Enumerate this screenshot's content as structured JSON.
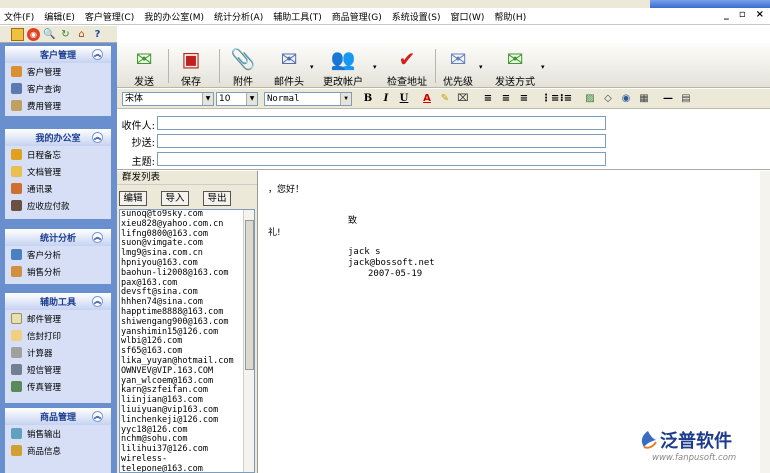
{
  "menu": [
    "文件(F)",
    "编辑(E)",
    "客户管理(C)",
    "我的办公室(M)",
    "统计分析(A)",
    "辅助工具(T)",
    "商品管理(G)",
    "系统设置(S)",
    "窗口(W)",
    "帮助(H)"
  ],
  "window_controls": [
    "_",
    "ₐ",
    "×"
  ],
  "sidebar": {
    "groups": [
      {
        "title": "客户管理",
        "items": [
          "客户管理",
          "客户查询",
          "费用管理"
        ]
      },
      {
        "title": "我的办公室",
        "items": [
          "日程备忘",
          "文档管理",
          "通讯录",
          "应收应付款"
        ]
      },
      {
        "title": "统计分析",
        "items": [
          "客户分析",
          "销售分析"
        ]
      },
      {
        "title": "辅助工具",
        "items": [
          "邮件管理",
          "信封打印",
          "计算器",
          "短信管理",
          "传真管理"
        ]
      },
      {
        "title": "商品管理",
        "items": [
          "销售输出",
          "商品信息"
        ]
      }
    ]
  },
  "toolbar": {
    "buttons": [
      "发送",
      "保存",
      "附件",
      "邮件头",
      "更改帐户",
      "检查地址",
      "优先级",
      "发送方式"
    ]
  },
  "format": {
    "font": "宋体",
    "size": "10",
    "style": "Normal",
    "buttons": [
      "B",
      "I",
      "U"
    ]
  },
  "header": {
    "to_label": "收件人:",
    "cc_label": "抄送:",
    "subject_label": "主题:"
  },
  "group_send": {
    "title": "群发列表",
    "buttons": [
      "编辑",
      "导入",
      "导出"
    ],
    "emails": [
      "sunoq@to9sky.com",
      "xieu828@yahoo.com.cn",
      "lifng0800@163.com",
      "suon@vimgate.com",
      "lmg9@sina.com.cn",
      "hpniyou@163.com",
      "baohun-li2008@163.com",
      "pax@163.com",
      "devsft@sina.com",
      "hhhen74@sina.com",
      "happtime8888@163.com",
      "shiwengang900@163.com",
      "yanshimin15@126.com",
      "wlbi@126.com",
      "sf65@163.com",
      "lika_yuyan@hotmail.com",
      "OWNVEV@VIP.163.COM",
      "yan_wlcoem@163.com",
      "karn@szfeifan.com",
      "liinjian@163.com",
      "liuiyuan@vip163.com",
      "linchenkeji@126.com",
      "yyc18@126.com",
      "nchm@sohu.com",
      "lilihui37@126.com",
      "wireless-",
      "telepone@163.com"
    ]
  },
  "body": {
    "greeting": "，您好！",
    "zhi": "致",
    "li": "礼!",
    "signer": "jack s",
    "signer_email": "jack@bossoft.net",
    "date": "2007-05-19"
  },
  "logo": {
    "brand": "泛普软件",
    "url": "www.fanpusoft.com"
  }
}
